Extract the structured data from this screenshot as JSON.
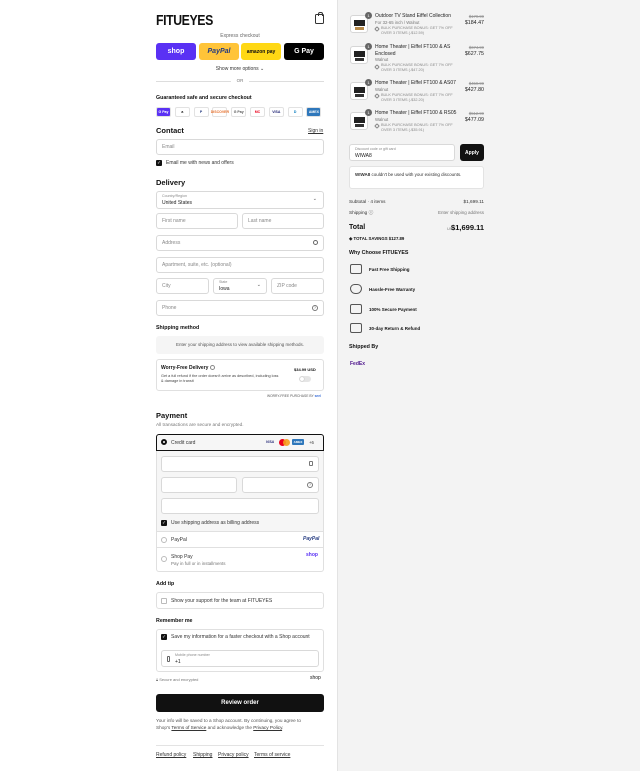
{
  "brand": {
    "logo": "FITUEYES"
  },
  "checkout": {
    "express_label": "Express checkout",
    "pay_buttons": {
      "shop": "shop",
      "paypal": "PayPal",
      "amazon": "amazon pay",
      "gpay": "G Pay"
    },
    "show_more": "Show more options",
    "or": "OR",
    "guarantee_title": "Guaranteed safe and secure checkout",
    "payment_icons": [
      "G Pay",
      "a",
      "P",
      "DISCOVER",
      "G Pay",
      "MC",
      "VISA",
      "D",
      "AMEX"
    ]
  },
  "contact": {
    "title": "Contact",
    "sign_in": "Sign in",
    "email_placeholder": "Email",
    "newsletter": "Email me with news and offers"
  },
  "delivery": {
    "title": "Delivery",
    "country_label": "Country/Region",
    "country_value": "United States",
    "first_name": "First name",
    "last_name": "Last name",
    "address": "Address",
    "apartment": "Apartment, suite, etc. (optional)",
    "city": "City",
    "state_label": "State",
    "state_value": "Iowa",
    "zip": "ZIP code",
    "phone": "Phone"
  },
  "shipping_method": {
    "title": "Shipping method",
    "note": "Enter your shipping address to view available shipping methods."
  },
  "worry_free": {
    "title": "Worry-Free Delivery",
    "desc": "Get a full refund if the order doesn't arrive as described, including loss & damage in transit",
    "price": "$34.99 USD",
    "footer": "WORRY-FREE PURCHASE BY",
    "footer_brand": "seel"
  },
  "payment": {
    "title": "Payment",
    "subtitle": "All transactions are secure and encrypted.",
    "credit_card": "Credit card",
    "card_brands": [
      "VISA",
      "MC",
      "AMEX"
    ],
    "more_brands": "+6",
    "billing_same": "Use shipping address as billing address",
    "paypal": "PayPal",
    "paypal_logo": "PayPal",
    "shop_pay": "Shop Pay",
    "shop_pay_sub": "Pay in full or in installments",
    "shop_logo": "shop"
  },
  "tip": {
    "title": "Add tip",
    "option": "Show your support for the team at FITUEYES"
  },
  "remember": {
    "title": "Remember me",
    "save_info": "Save my information for a faster checkout with a Shop account",
    "phone_label": "Mobile phone number",
    "phone_value": "+1",
    "secure": "Secure and encrypted",
    "shop": "shop"
  },
  "review_button": "Review order",
  "legal": {
    "line1": "Your info will be saved to a Shop account. By continuing, you agree to",
    "line2_pre": "Shop's",
    "terms": "Terms of Service",
    "line2_mid": "and acknowledge the",
    "privacy": "Privacy Policy",
    "line2_end": "."
  },
  "footer_links": [
    "Refund policy",
    "Shipping",
    "Privacy policy",
    "Terms of service"
  ],
  "cart": {
    "items": [
      {
        "qty": "1",
        "title": "Outdoor TV Stand Eiffel Collection",
        "variant": "For 32-65 inch / Walnut",
        "bonus": "BULK PURCHASE BONUS: GET 7% OFF OVER 3 ITEMS (-$12.59)",
        "old_price": "$179.99",
        "price": "$184.47"
      },
      {
        "qty": "1",
        "title": "Home Theater | Eiffel FT100 & AS Enclosed",
        "variant": "Walnut",
        "bonus": "BULK PURCHASE BONUS: GET 7% OFF OVER 3 ITEMS (-$47.20)",
        "old_price": "$674.99",
        "price": "$627.75"
      },
      {
        "qty": "1",
        "title": "Home Theater | Eiffel FT100 & AS07",
        "variant": "Walnut",
        "bonus": "BULK PURCHASE BONUS: GET 7% OFF OVER 3 ITEMS (-$32.20)",
        "old_price": "$459.99",
        "price": "$427.80"
      },
      {
        "qty": "1",
        "title": "Home Theater | Eiffel FT100 & RS05",
        "variant": "Walnut",
        "bonus": "BULK PURCHASE BONUS: GET 7% OFF OVER 3 ITEMS (-$35.91)",
        "old_price": "$512.99",
        "price": "$477.09"
      }
    ],
    "discount_label": "Discount code or gift card",
    "discount_value": "WIWA8",
    "apply": "Apply",
    "error_code": "WIWA8",
    "error_text": "couldn't be used with your existing discounts.",
    "subtotal_label": "Subtotal · 4 items",
    "subtotal_value": "$1,699.11",
    "shipping_label": "Shipping",
    "shipping_value": "Enter shipping address",
    "total_label": "Total",
    "currency": "USD",
    "total_value": "$1,699.11",
    "savings_label": "TOTAL SAVINGS",
    "savings_value": "$127.89"
  },
  "why": {
    "title": "Why Choose FITUEYES",
    "items": [
      "Fast Free Shipping",
      "Hassle-Free Warranty",
      "100% Secure Payment",
      "30-day Return & Refund"
    ]
  },
  "shipped_by": {
    "title": "Shipped By",
    "carrier": "FedEx"
  },
  "colors": {
    "shop": "#5a31f4",
    "paypal": "#ffc439",
    "amazon": "#ffd814",
    "gpay": "#000000",
    "accent": "#111111"
  }
}
